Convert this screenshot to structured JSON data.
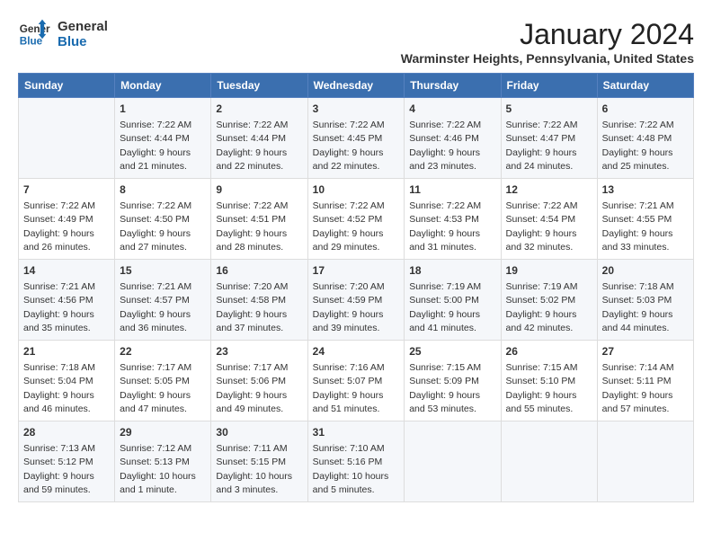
{
  "header": {
    "logo_line1": "General",
    "logo_line2": "Blue",
    "month_title": "January 2024",
    "subtitle": "Warminster Heights, Pennsylvania, United States"
  },
  "days_of_week": [
    "Sunday",
    "Monday",
    "Tuesday",
    "Wednesday",
    "Thursday",
    "Friday",
    "Saturday"
  ],
  "weeks": [
    [
      {
        "day": "",
        "sunrise": "",
        "sunset": "",
        "daylight": ""
      },
      {
        "day": "1",
        "sunrise": "Sunrise: 7:22 AM",
        "sunset": "Sunset: 4:44 PM",
        "daylight": "Daylight: 9 hours and 21 minutes."
      },
      {
        "day": "2",
        "sunrise": "Sunrise: 7:22 AM",
        "sunset": "Sunset: 4:44 PM",
        "daylight": "Daylight: 9 hours and 22 minutes."
      },
      {
        "day": "3",
        "sunrise": "Sunrise: 7:22 AM",
        "sunset": "Sunset: 4:45 PM",
        "daylight": "Daylight: 9 hours and 22 minutes."
      },
      {
        "day": "4",
        "sunrise": "Sunrise: 7:22 AM",
        "sunset": "Sunset: 4:46 PM",
        "daylight": "Daylight: 9 hours and 23 minutes."
      },
      {
        "day": "5",
        "sunrise": "Sunrise: 7:22 AM",
        "sunset": "Sunset: 4:47 PM",
        "daylight": "Daylight: 9 hours and 24 minutes."
      },
      {
        "day": "6",
        "sunrise": "Sunrise: 7:22 AM",
        "sunset": "Sunset: 4:48 PM",
        "daylight": "Daylight: 9 hours and 25 minutes."
      }
    ],
    [
      {
        "day": "7",
        "sunrise": "Sunrise: 7:22 AM",
        "sunset": "Sunset: 4:49 PM",
        "daylight": "Daylight: 9 hours and 26 minutes."
      },
      {
        "day": "8",
        "sunrise": "Sunrise: 7:22 AM",
        "sunset": "Sunset: 4:50 PM",
        "daylight": "Daylight: 9 hours and 27 minutes."
      },
      {
        "day": "9",
        "sunrise": "Sunrise: 7:22 AM",
        "sunset": "Sunset: 4:51 PM",
        "daylight": "Daylight: 9 hours and 28 minutes."
      },
      {
        "day": "10",
        "sunrise": "Sunrise: 7:22 AM",
        "sunset": "Sunset: 4:52 PM",
        "daylight": "Daylight: 9 hours and 29 minutes."
      },
      {
        "day": "11",
        "sunrise": "Sunrise: 7:22 AM",
        "sunset": "Sunset: 4:53 PM",
        "daylight": "Daylight: 9 hours and 31 minutes."
      },
      {
        "day": "12",
        "sunrise": "Sunrise: 7:22 AM",
        "sunset": "Sunset: 4:54 PM",
        "daylight": "Daylight: 9 hours and 32 minutes."
      },
      {
        "day": "13",
        "sunrise": "Sunrise: 7:21 AM",
        "sunset": "Sunset: 4:55 PM",
        "daylight": "Daylight: 9 hours and 33 minutes."
      }
    ],
    [
      {
        "day": "14",
        "sunrise": "Sunrise: 7:21 AM",
        "sunset": "Sunset: 4:56 PM",
        "daylight": "Daylight: 9 hours and 35 minutes."
      },
      {
        "day": "15",
        "sunrise": "Sunrise: 7:21 AM",
        "sunset": "Sunset: 4:57 PM",
        "daylight": "Daylight: 9 hours and 36 minutes."
      },
      {
        "day": "16",
        "sunrise": "Sunrise: 7:20 AM",
        "sunset": "Sunset: 4:58 PM",
        "daylight": "Daylight: 9 hours and 37 minutes."
      },
      {
        "day": "17",
        "sunrise": "Sunrise: 7:20 AM",
        "sunset": "Sunset: 4:59 PM",
        "daylight": "Daylight: 9 hours and 39 minutes."
      },
      {
        "day": "18",
        "sunrise": "Sunrise: 7:19 AM",
        "sunset": "Sunset: 5:00 PM",
        "daylight": "Daylight: 9 hours and 41 minutes."
      },
      {
        "day": "19",
        "sunrise": "Sunrise: 7:19 AM",
        "sunset": "Sunset: 5:02 PM",
        "daylight": "Daylight: 9 hours and 42 minutes."
      },
      {
        "day": "20",
        "sunrise": "Sunrise: 7:18 AM",
        "sunset": "Sunset: 5:03 PM",
        "daylight": "Daylight: 9 hours and 44 minutes."
      }
    ],
    [
      {
        "day": "21",
        "sunrise": "Sunrise: 7:18 AM",
        "sunset": "Sunset: 5:04 PM",
        "daylight": "Daylight: 9 hours and 46 minutes."
      },
      {
        "day": "22",
        "sunrise": "Sunrise: 7:17 AM",
        "sunset": "Sunset: 5:05 PM",
        "daylight": "Daylight: 9 hours and 47 minutes."
      },
      {
        "day": "23",
        "sunrise": "Sunrise: 7:17 AM",
        "sunset": "Sunset: 5:06 PM",
        "daylight": "Daylight: 9 hours and 49 minutes."
      },
      {
        "day": "24",
        "sunrise": "Sunrise: 7:16 AM",
        "sunset": "Sunset: 5:07 PM",
        "daylight": "Daylight: 9 hours and 51 minutes."
      },
      {
        "day": "25",
        "sunrise": "Sunrise: 7:15 AM",
        "sunset": "Sunset: 5:09 PM",
        "daylight": "Daylight: 9 hours and 53 minutes."
      },
      {
        "day": "26",
        "sunrise": "Sunrise: 7:15 AM",
        "sunset": "Sunset: 5:10 PM",
        "daylight": "Daylight: 9 hours and 55 minutes."
      },
      {
        "day": "27",
        "sunrise": "Sunrise: 7:14 AM",
        "sunset": "Sunset: 5:11 PM",
        "daylight": "Daylight: 9 hours and 57 minutes."
      }
    ],
    [
      {
        "day": "28",
        "sunrise": "Sunrise: 7:13 AM",
        "sunset": "Sunset: 5:12 PM",
        "daylight": "Daylight: 9 hours and 59 minutes."
      },
      {
        "day": "29",
        "sunrise": "Sunrise: 7:12 AM",
        "sunset": "Sunset: 5:13 PM",
        "daylight": "Daylight: 10 hours and 1 minute."
      },
      {
        "day": "30",
        "sunrise": "Sunrise: 7:11 AM",
        "sunset": "Sunset: 5:15 PM",
        "daylight": "Daylight: 10 hours and 3 minutes."
      },
      {
        "day": "31",
        "sunrise": "Sunrise: 7:10 AM",
        "sunset": "Sunset: 5:16 PM",
        "daylight": "Daylight: 10 hours and 5 minutes."
      },
      {
        "day": "",
        "sunrise": "",
        "sunset": "",
        "daylight": ""
      },
      {
        "day": "",
        "sunrise": "",
        "sunset": "",
        "daylight": ""
      },
      {
        "day": "",
        "sunrise": "",
        "sunset": "",
        "daylight": ""
      }
    ]
  ]
}
